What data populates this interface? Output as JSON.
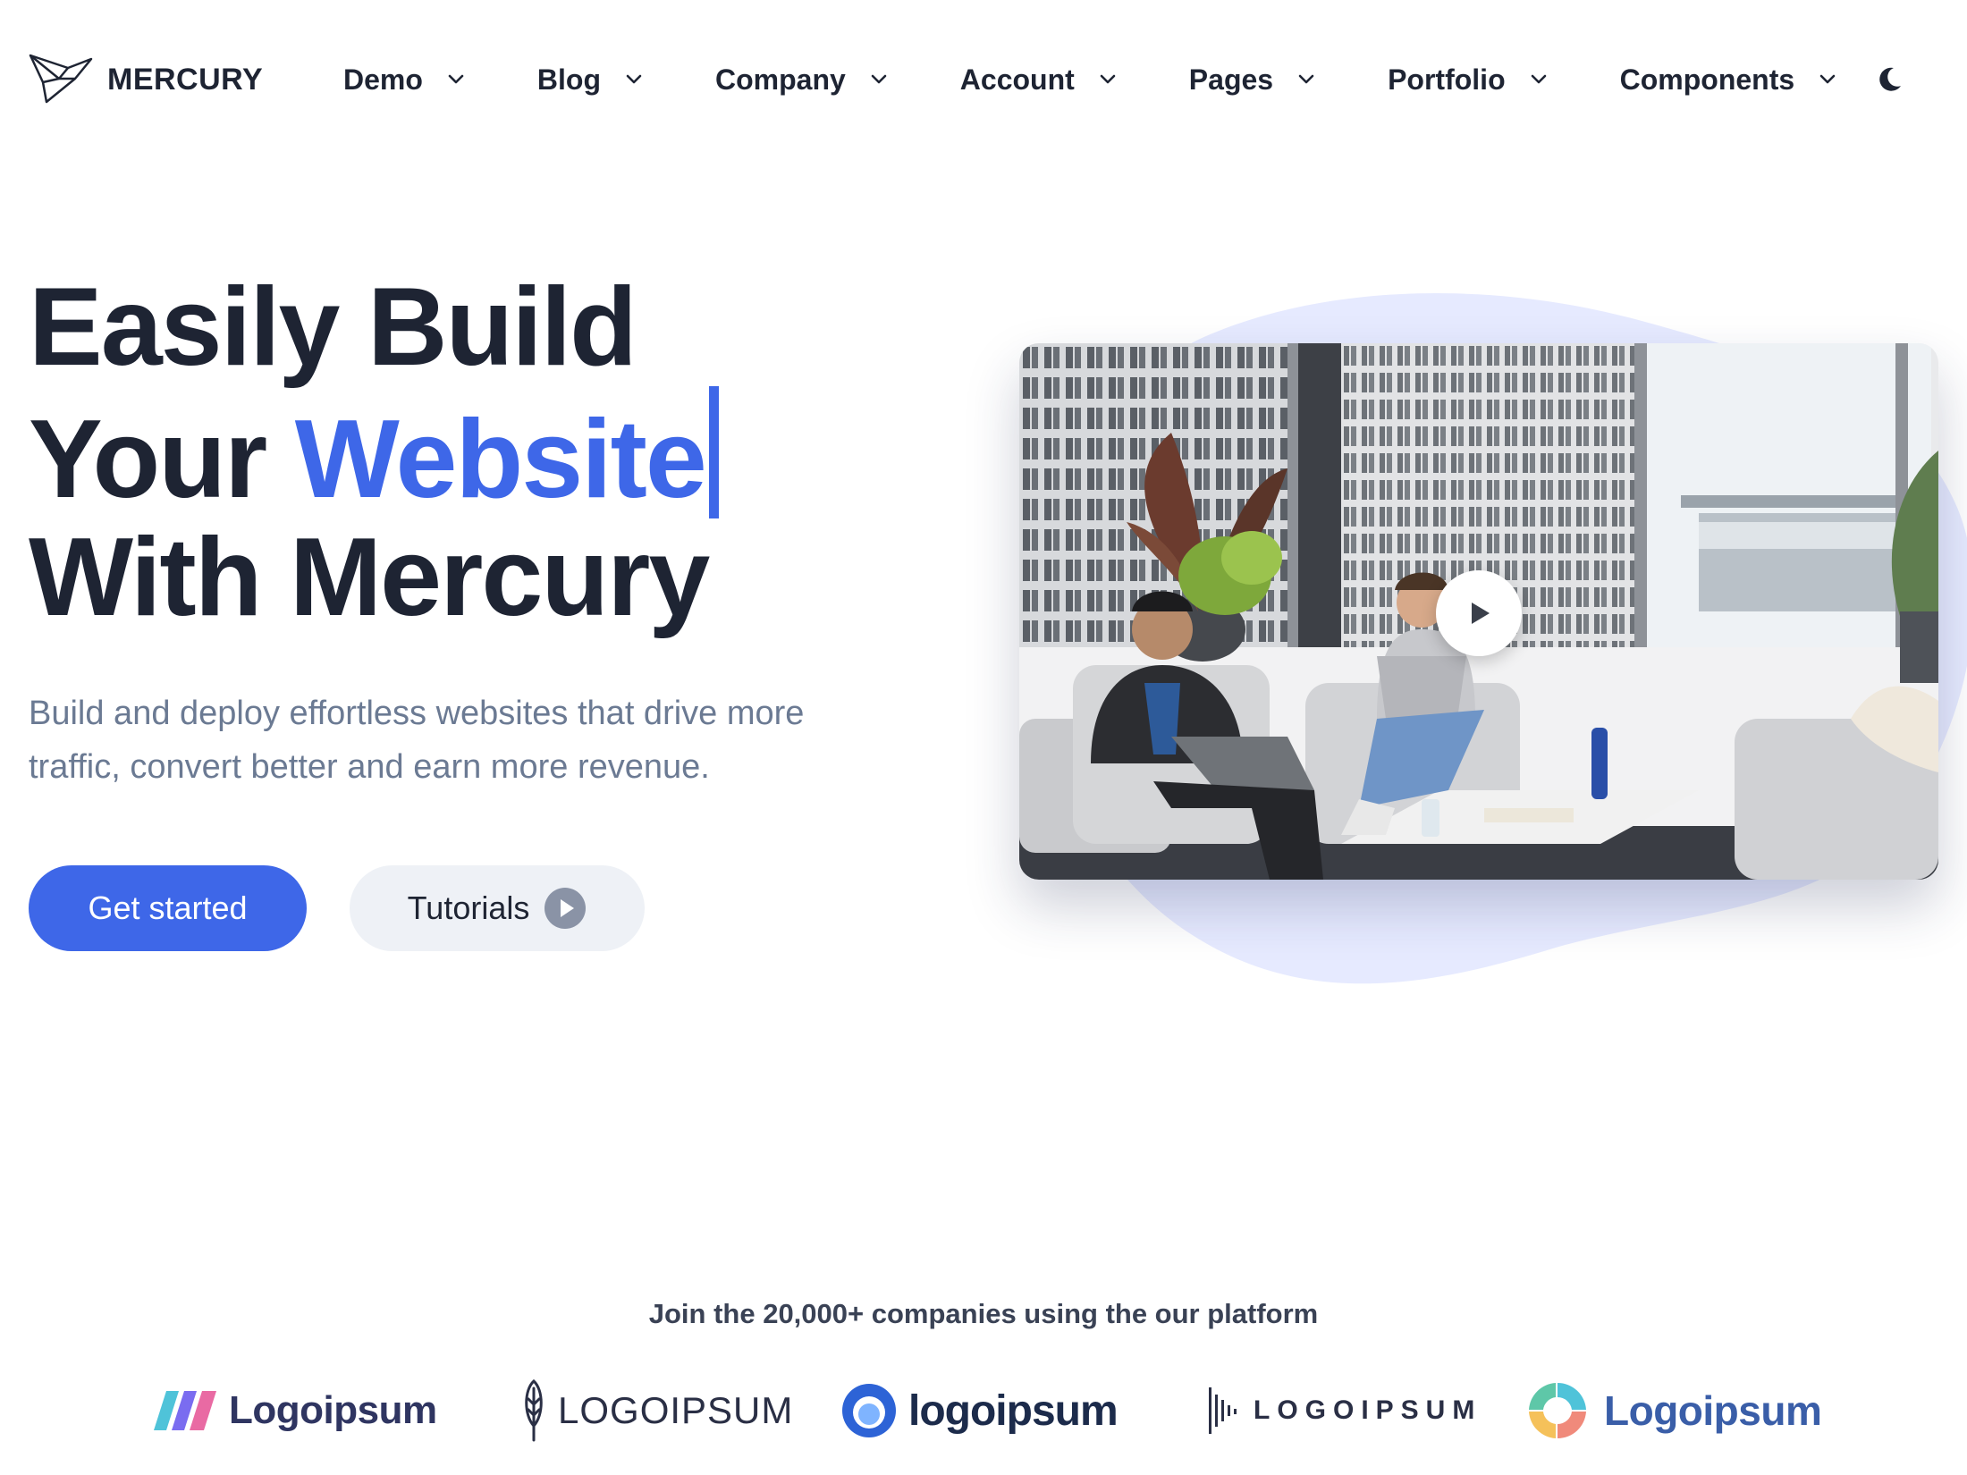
{
  "brand": {
    "name": "MERCURY",
    "icon": "paper-bird-icon"
  },
  "nav": {
    "items": [
      {
        "label": "Demo"
      },
      {
        "label": "Blog"
      },
      {
        "label": "Company"
      },
      {
        "label": "Account"
      },
      {
        "label": "Pages"
      },
      {
        "label": "Portfolio"
      },
      {
        "label": "Components"
      }
    ],
    "dropdown_icon": "chevron-down-icon",
    "theme_icon": "moon-icon"
  },
  "hero": {
    "line1": "Easily Build",
    "line2_prefix": "Your ",
    "line2_accent": "Website",
    "line3": "With Mercury",
    "subtitle": "Build and deploy effortless websites that drive more traffic, convert better and earn more revenue.",
    "primary_button": "Get started",
    "secondary_button": "Tutorials"
  },
  "media": {
    "play_icon": "play-icon"
  },
  "logos": {
    "caption": "Join the 20,000+ companies using the our platform",
    "items": [
      {
        "text": "Logoipsum"
      },
      {
        "text": "LOGOIPSUM"
      },
      {
        "text": "logoipsum"
      },
      {
        "text": "LOGOIPSUM"
      },
      {
        "text": "Logoipsum"
      }
    ]
  },
  "colors": {
    "accent": "#3e67e8",
    "heading": "#1e2433",
    "muted": "#6b7a93",
    "secondary_button_bg": "#eef1f6",
    "blob": "#e6eaff"
  }
}
